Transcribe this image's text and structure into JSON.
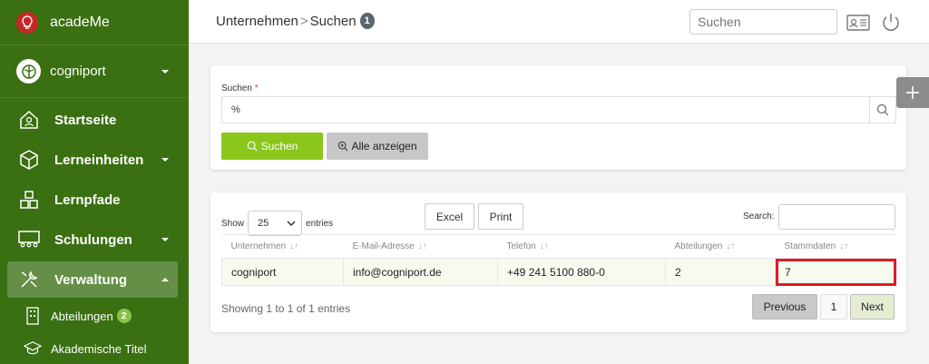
{
  "app": {
    "name": "acadeMe"
  },
  "org": {
    "name": "cogniport"
  },
  "nav": {
    "items": [
      {
        "label": "Startseite",
        "icon": "home-icon"
      },
      {
        "label": "Lerneinheiten",
        "icon": "cube-icon"
      },
      {
        "label": "Lernpfade",
        "icon": "blocks-icon"
      },
      {
        "label": "Schulungen",
        "icon": "presentation-icon"
      },
      {
        "label": "Verwaltung",
        "icon": "tools-icon"
      }
    ],
    "sub": [
      {
        "label": "Abteilungen",
        "badge": "2",
        "icon": "building-icon"
      },
      {
        "label": "Akademische Titel",
        "icon": "graduation-cap-icon"
      }
    ]
  },
  "header": {
    "crumb1": "Unternehmen",
    "sep": ">",
    "crumb2": "Suchen",
    "count": "1",
    "search_placeholder": "Suchen"
  },
  "search_panel": {
    "label": "Suchen",
    "required": "*",
    "value": "%",
    "search_button": "Suchen",
    "show_all_button": "Alle anzeigen"
  },
  "table_panel": {
    "show": "Show",
    "entries_value": "25",
    "entries": "entries",
    "excel": "Excel",
    "print": "Print",
    "search_label": "Search:",
    "columns": [
      "Unternehmen",
      "E-Mail-Adresse",
      "Telefon",
      "Abteilungen",
      "Stammdaten"
    ],
    "rows": [
      [
        "cogniport",
        "info@cogniport.de",
        "+49 241 5100 880-0",
        "2",
        "7"
      ]
    ],
    "info": "Showing 1 to 1 of 1 entries",
    "prev": "Previous",
    "page": "1",
    "next": "Next"
  },
  "colors": {
    "sidebar": "#3a6f12",
    "accent": "#8bc61b",
    "highlight": "#e01b24"
  }
}
